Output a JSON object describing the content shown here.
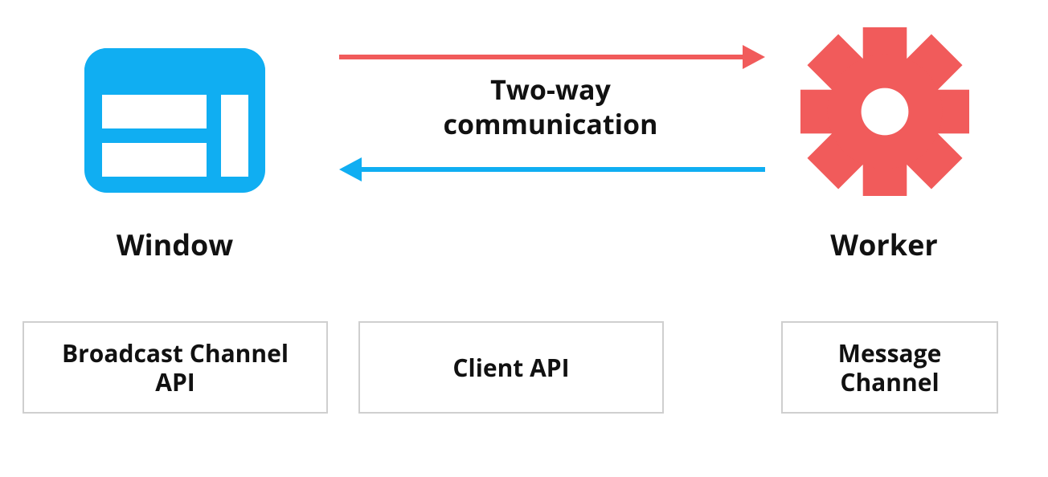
{
  "colors": {
    "window": "#10aef2",
    "worker": "#f15b5b",
    "arrow_to_worker": "#f15b5b",
    "arrow_to_window": "#10aef2",
    "box_border": "#cfcfcf"
  },
  "labels": {
    "window": "Window",
    "worker": "Worker",
    "center_line1": "Two-way",
    "center_line2": "communication"
  },
  "apis": {
    "box1_line1": "Broadcast Channel",
    "box1_line2": "API",
    "box2": "Client API",
    "box3_line1": "Message",
    "box3_line2": "Channel"
  }
}
